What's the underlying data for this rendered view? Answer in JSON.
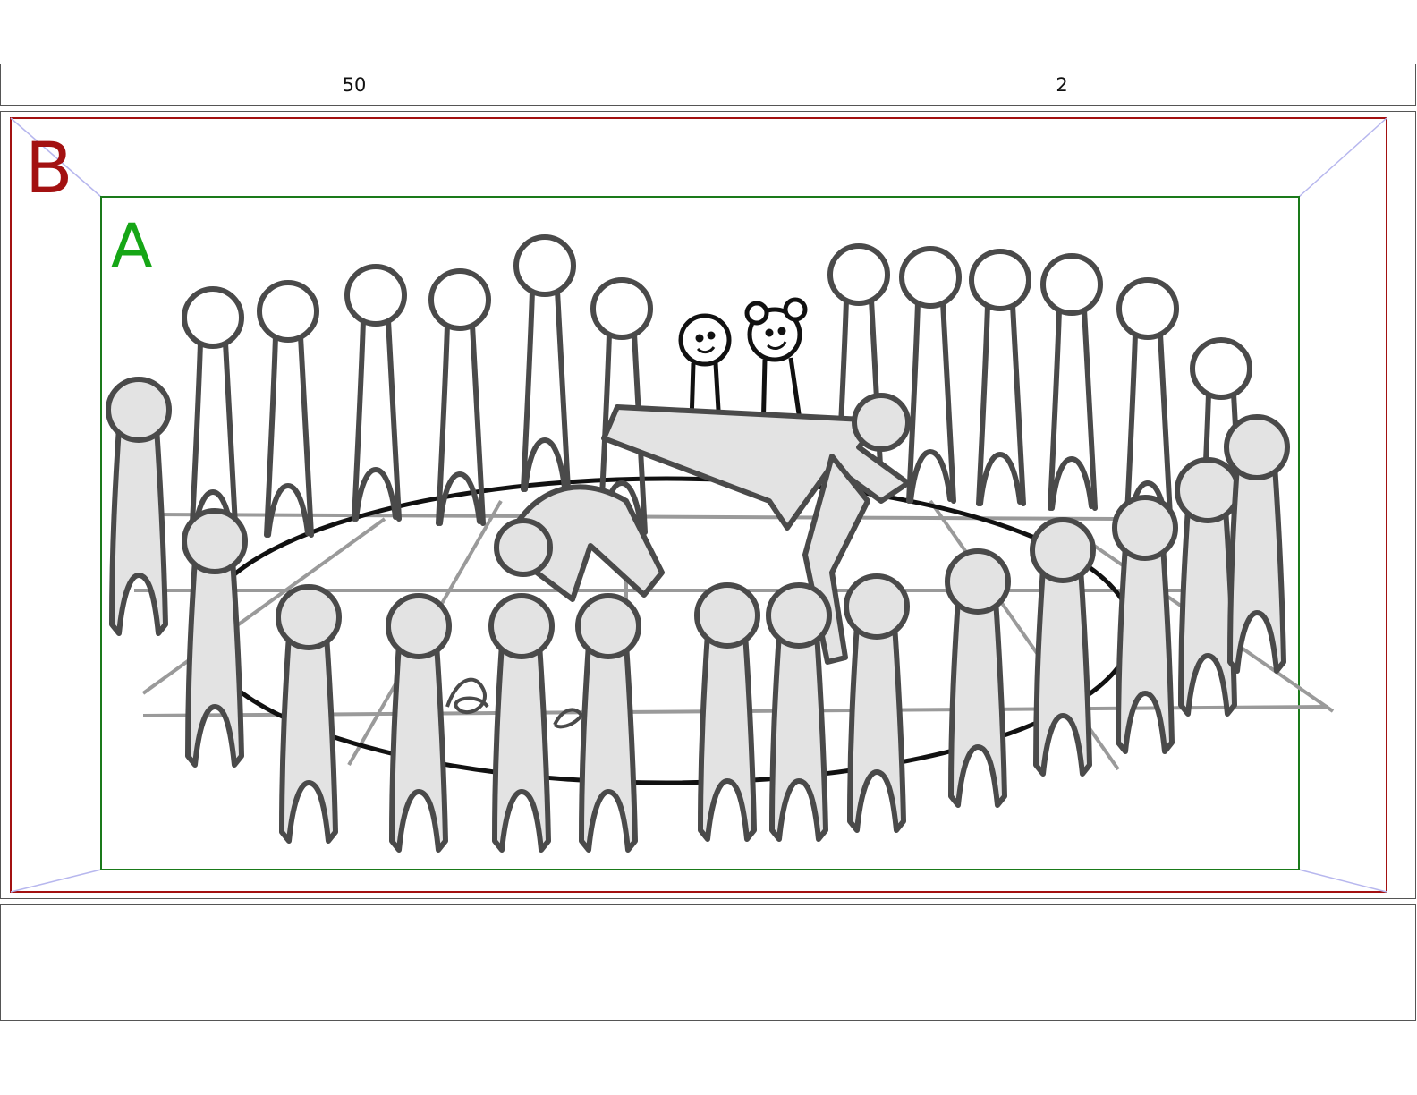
{
  "header": {
    "shot_number": "50",
    "panel_number": "2"
  },
  "frame": {
    "outer_label": "B",
    "inner_label": "A",
    "outer_color": "#a31111",
    "inner_color": "#1a7a1a",
    "sketch_fill": "#e3e3e3",
    "sketch_stroke": "#4a4a4a"
  },
  "notes": {
    "text": ""
  }
}
